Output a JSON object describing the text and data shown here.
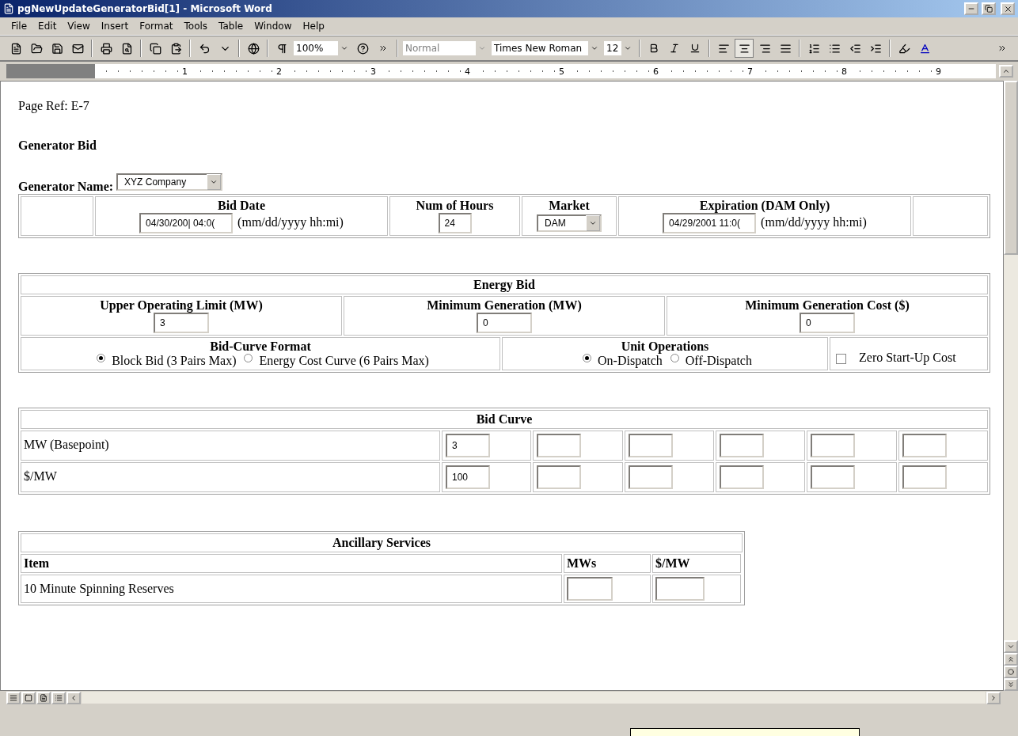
{
  "window": {
    "title": "pgNewUpdateGeneratorBid[1] - Microsoft Word"
  },
  "menu": [
    "File",
    "Edit",
    "View",
    "Insert",
    "Format",
    "Tools",
    "Table",
    "Window",
    "Help"
  ],
  "toolbar": {
    "zoom": "100%",
    "style": "Normal",
    "font": "Times New Roman",
    "size": "12",
    "align_buttons": [
      {
        "selected": false
      },
      {
        "selected": true
      },
      {
        "selected": false
      },
      {
        "selected": false
      }
    ]
  },
  "ruler": [
    "1",
    "2",
    "3",
    "4",
    "5",
    "6",
    "7",
    "8",
    "9"
  ],
  "document": {
    "page_ref": "Page Ref: E-7",
    "heading": "Generator Bid",
    "generator_name": {
      "label": "Generator Name:",
      "value": "XYZ Company"
    },
    "bid_info": [
      {
        "kind": "input",
        "label": "Bid Date",
        "value": "04/30/200| 04:0(",
        "hint": "(mm/dd/yyyy hh:mi)"
      },
      {
        "kind": "input",
        "label": "Num of Hours",
        "value": "24"
      },
      {
        "kind": "select",
        "label": "Market",
        "value": "DAM"
      },
      {
        "kind": "input",
        "label": "Expiration (DAM Only)",
        "value": "04/29/2001 11:0(",
        "hint": "(mm/dd/yyyy hh:mi)"
      }
    ],
    "energy_bid": {
      "title": "Energy Bid",
      "fields": [
        {
          "label": "Upper Operating Limit (MW)",
          "value": "3"
        },
        {
          "label": "Minimum Generation (MW)",
          "value": "0"
        },
        {
          "label": "Minimum Generation Cost ($)",
          "value": "0"
        }
      ],
      "bid_curve_format": {
        "label": "Bid-Curve Format",
        "options": [
          {
            "label": "Block Bid (3 Pairs Max)",
            "selected": true
          },
          {
            "label": "Energy Cost Curve (6 Pairs Max)",
            "selected": false
          }
        ]
      },
      "unit_operations": {
        "label": "Unit Operations",
        "options": [
          {
            "label": "On-Dispatch",
            "selected": true
          },
          {
            "label": "Off-Dispatch",
            "selected": false
          }
        ]
      },
      "zero_startup": {
        "label": "Zero Start-Up Cost",
        "checked": false
      }
    },
    "bid_curve": {
      "title": "Bid Curve",
      "rows": [
        {
          "label": "MW (Basepoint)",
          "values": [
            "3"
          ]
        },
        {
          "label": "$/MW",
          "values": [
            "100"
          ]
        }
      ]
    },
    "ancillary": {
      "title": "Ancillary Services",
      "columns": [
        "Item",
        "MWs",
        "$/MW"
      ],
      "rows": [
        {
          "label": "10 Minute Spinning Reserves"
        }
      ]
    }
  }
}
